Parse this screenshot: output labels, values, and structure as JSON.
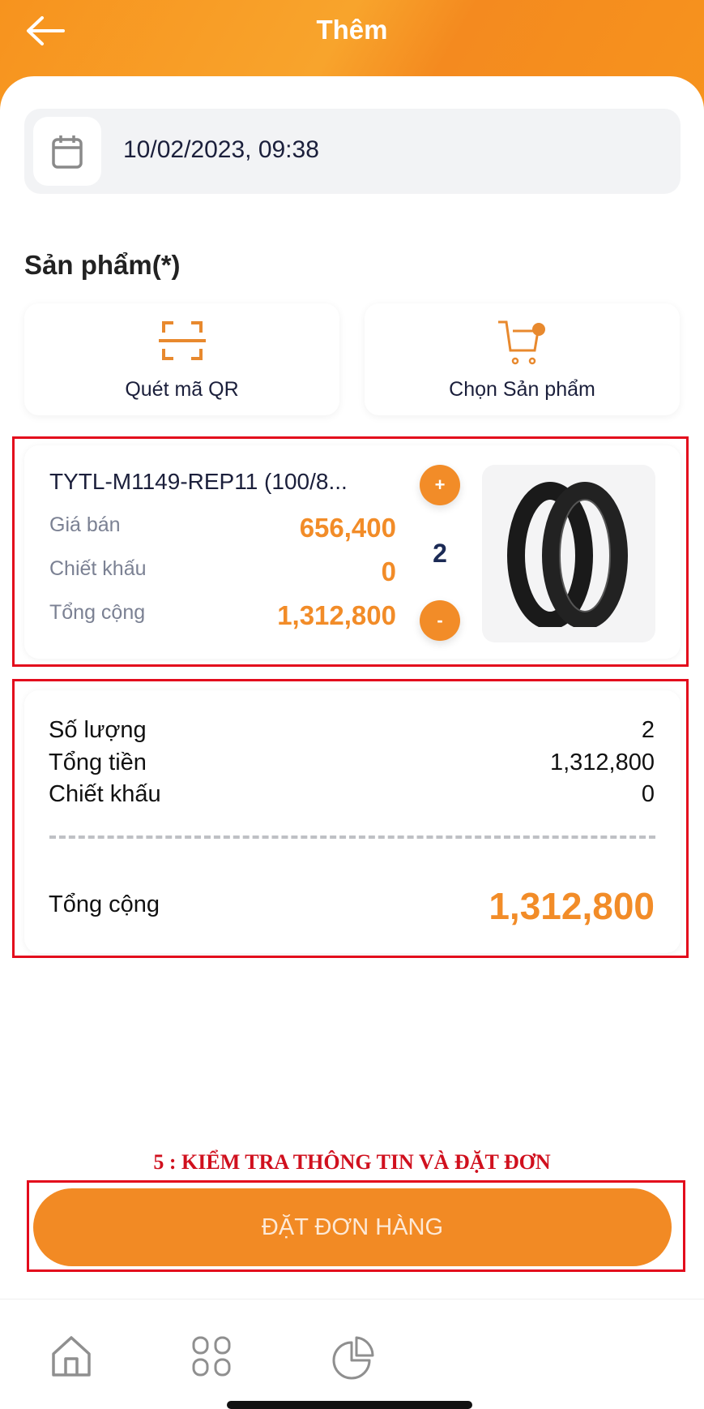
{
  "header": {
    "title": "Thêm",
    "back_icon": "arrow-left-icon"
  },
  "date": {
    "value": "10/02/2023, 09:38",
    "icon": "calendar-icon"
  },
  "products_section": {
    "title": "Sản phẩm(*)",
    "scan_qr_label": "Quét mã QR",
    "choose_product_label": "Chọn Sản phẩm"
  },
  "product": {
    "name": "TYTL-M1149-REP11 (100/8...",
    "price_label": "Giá bán",
    "price": "656,400",
    "discount_label": "Chiết khấu",
    "discount": "0",
    "total_label": "Tổng cộng",
    "total": "1,312,800",
    "quantity": "2",
    "plus": "+",
    "minus": "-"
  },
  "summary": {
    "qty_label": "Số lượng",
    "qty": "2",
    "subtotal_label": "Tổng tiền",
    "subtotal": "1,312,800",
    "discount_label": "Chiết khấu",
    "discount": "0",
    "total_label": "Tổng cộng",
    "total": "1,312,800"
  },
  "annotation": "5 : KIỂM TRA THÔNG TIN VÀ ĐẶT ĐƠN",
  "order_button": "ĐẶT ĐƠN HÀNG",
  "nav": {
    "items": [
      "home-icon",
      "grid-icon",
      "pie-chart-icon"
    ]
  },
  "colors": {
    "accent": "#f28c28",
    "highlight": "#e30b1c"
  }
}
